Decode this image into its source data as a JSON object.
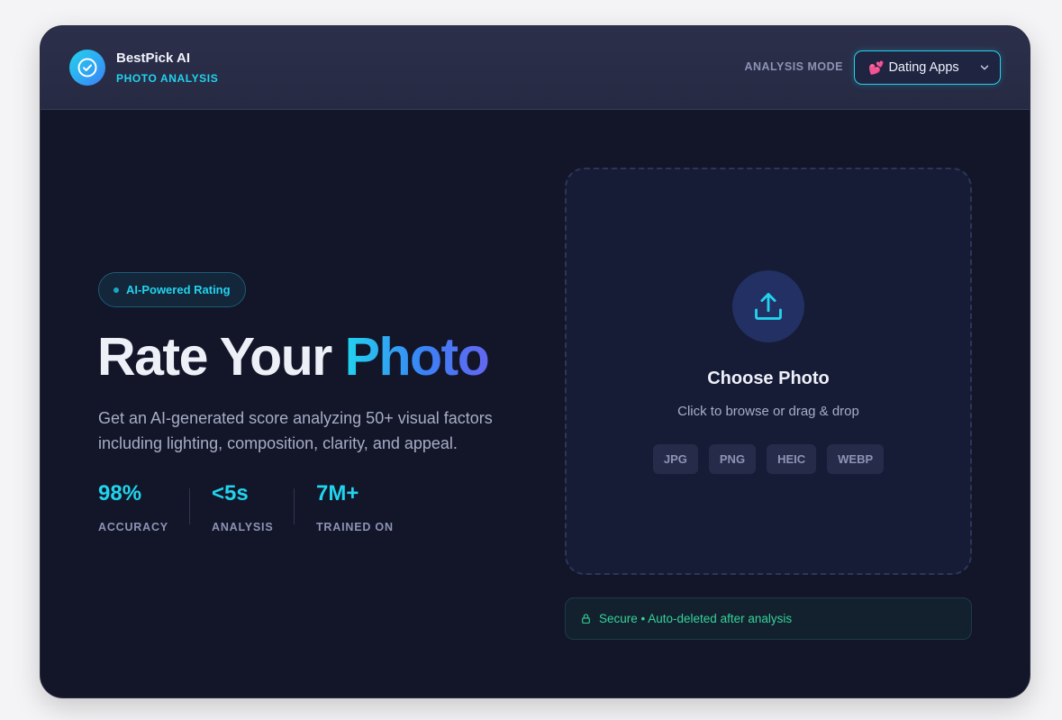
{
  "brand": {
    "name": "BestPick AI",
    "subtitle": "PHOTO ANALYSIS",
    "logo_icon": "check-circle-icon"
  },
  "header": {
    "mode_label": "ANALYSIS MODE",
    "mode_select": {
      "emoji": "💕",
      "value": "Dating Apps",
      "icon": "chevron-down-icon"
    }
  },
  "hero": {
    "badge": "AI-Powered Rating",
    "title_main": "Rate Your ",
    "title_accent": "Photo",
    "description": "Get an AI-generated score analyzing 50+ visual factors including lighting, composition, clarity, and appeal."
  },
  "stats": [
    {
      "value": "98%",
      "label": "ACCURACY"
    },
    {
      "value": "<5s",
      "label": "ANALYSIS"
    },
    {
      "value": "7M+",
      "label": "TRAINED ON"
    }
  ],
  "upload": {
    "icon": "upload-icon",
    "title": "Choose Photo",
    "subtitle": "Click to browse or drag & drop",
    "formats": [
      "JPG",
      "PNG",
      "HEIC",
      "WEBP"
    ]
  },
  "secure_note": {
    "icon": "lock-icon",
    "text": "Secure • Auto-deleted after analysis"
  },
  "colors": {
    "accent": "#22d3ee",
    "background": "#121628",
    "header": "#2a2d47",
    "success": "#34d399"
  }
}
